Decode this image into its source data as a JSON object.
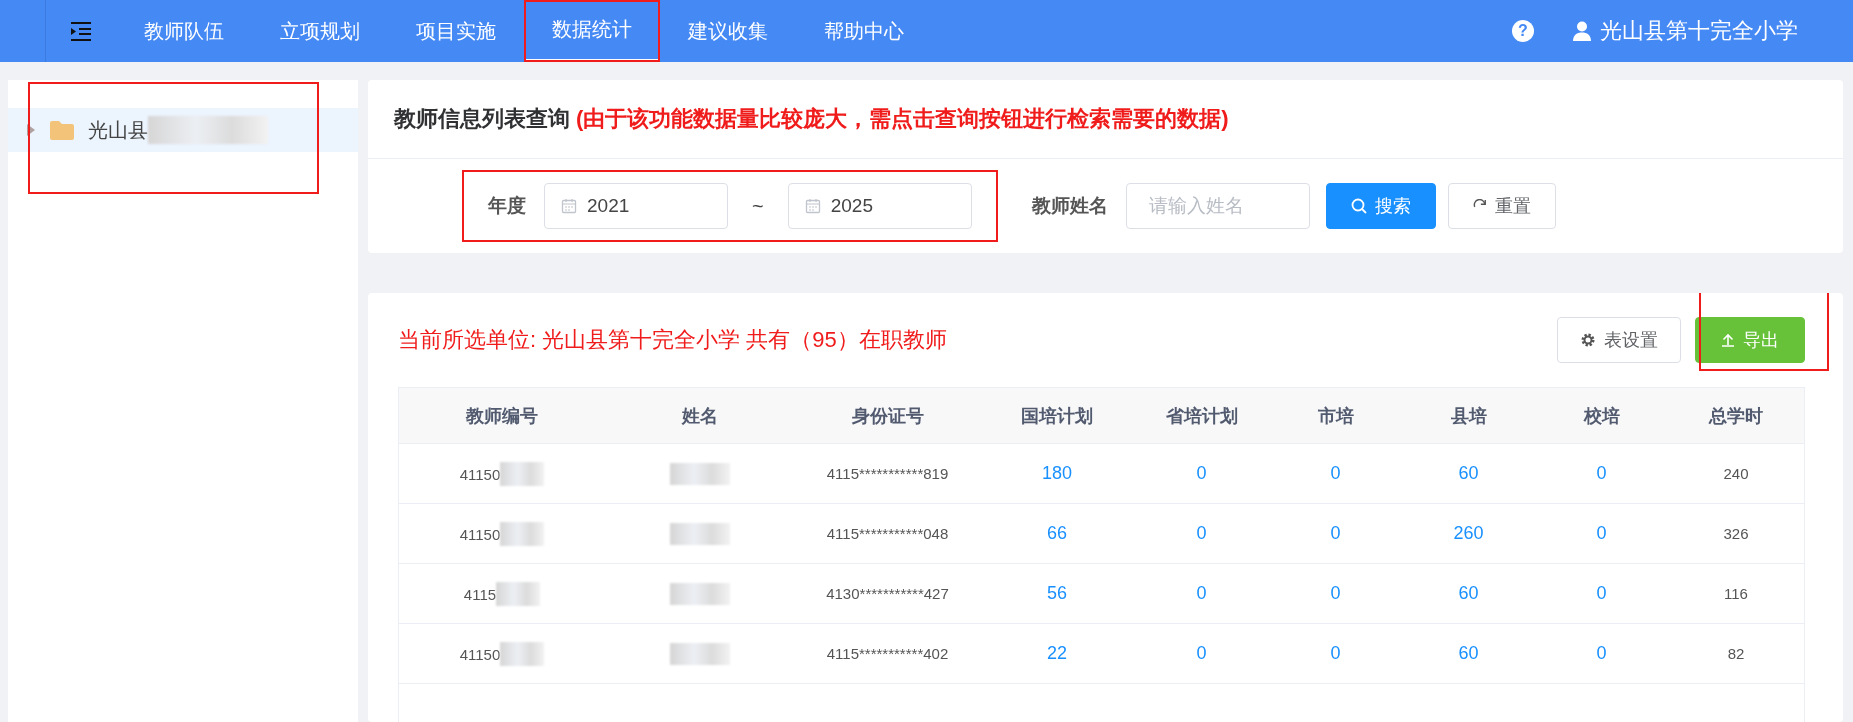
{
  "nav": {
    "items": [
      {
        "label": "教师队伍",
        "selected": false,
        "highlighted": false
      },
      {
        "label": "立项规划",
        "selected": false,
        "highlighted": false
      },
      {
        "label": "项目实施",
        "selected": false,
        "highlighted": false
      },
      {
        "label": "数据统计",
        "selected": true,
        "highlighted": true
      },
      {
        "label": "建议收集",
        "selected": false,
        "highlighted": false
      },
      {
        "label": "帮助中心",
        "selected": false,
        "highlighted": false
      }
    ],
    "help": "?",
    "user": "光山县第十完全小学"
  },
  "sidebar": {
    "tree": [
      {
        "label": "光山县",
        "selected": true,
        "highlighted": true
      }
    ]
  },
  "query": {
    "title": "教师信息列表查询",
    "note": "(由于该功能数据量比较庞大，需点击查询按钮进行检索需要的数据)",
    "year_label": "年度",
    "year_from": "2021",
    "separator": "~",
    "year_to": "2025",
    "year_highlighted": true,
    "name_label": "教师姓名",
    "name_placeholder": "请输入姓名",
    "buttons": [
      {
        "label": "搜索",
        "kind": "search"
      },
      {
        "label": "重置",
        "kind": "reset"
      }
    ]
  },
  "results": {
    "summary": "当前所选单位: 光山县第十完全小学 共有（95）在职教师",
    "buttons": [
      {
        "label": "表设置",
        "kind": "settings",
        "highlighted": false
      },
      {
        "label": "导出",
        "kind": "export",
        "highlighted": true
      }
    ],
    "table": {
      "columns": [
        "教师编号",
        "姓名",
        "身份证号",
        "国培计划",
        "省培计划",
        "市培",
        "县培",
        "校培",
        "总学时"
      ],
      "rows": [
        {
          "teacher_no": "41150",
          "id_no": "4115***********819",
          "national": "180",
          "provincial": "0",
          "city": "0",
          "county": "60",
          "school": "0",
          "total": "240"
        },
        {
          "teacher_no": "41150",
          "id_no": "4115***********048",
          "national": "66",
          "provincial": "0",
          "city": "0",
          "county": "260",
          "school": "0",
          "total": "326"
        },
        {
          "teacher_no": "4115",
          "id_no": "4130***********427",
          "national": "56",
          "provincial": "0",
          "city": "0",
          "county": "60",
          "school": "0",
          "total": "116"
        },
        {
          "teacher_no": "41150",
          "id_no": "4115***********402",
          "national": "22",
          "provincial": "0",
          "city": "0",
          "county": "60",
          "school": "0",
          "total": "82"
        }
      ]
    }
  }
}
